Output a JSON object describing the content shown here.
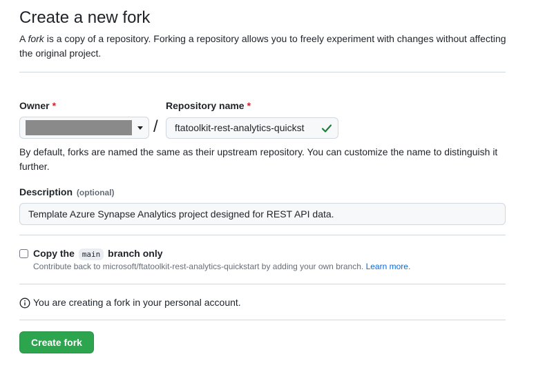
{
  "header": {
    "title": "Create a new fork",
    "intro_prefix": "A ",
    "intro_emphasis": "fork",
    "intro_suffix": " is a copy of a repository. Forking a repository allows you to freely experiment with changes without affecting the original project."
  },
  "owner": {
    "label": "Owner",
    "required_mark": "*",
    "icon": "chevron-down-icon"
  },
  "separator": "/",
  "repository": {
    "label": "Repository name",
    "required_mark": "*",
    "value": "ftatoolkit-rest-analytics-quickst",
    "status_icon": "check-icon",
    "status_color": "#1a7f37"
  },
  "naming_hint": "By default, forks are named the same as their upstream repository. You can customize the name to distinguish it further.",
  "description": {
    "label": "Description",
    "optional": "(optional)",
    "value": "Template Azure Synapse Analytics project designed for REST API data."
  },
  "copy_branch": {
    "checked": false,
    "label_before": "Copy the",
    "branch": "main",
    "label_after": "branch only",
    "note": "Contribute back to microsoft/ftatoolkit-rest-analytics-quickstart by adding your own branch.",
    "link_text": "Learn more",
    "link_suffix": "."
  },
  "account_notice": {
    "icon": "info-icon",
    "text": "You are creating a fork in your personal account."
  },
  "actions": {
    "create_label": "Create fork",
    "create_color": "#2da44e"
  }
}
